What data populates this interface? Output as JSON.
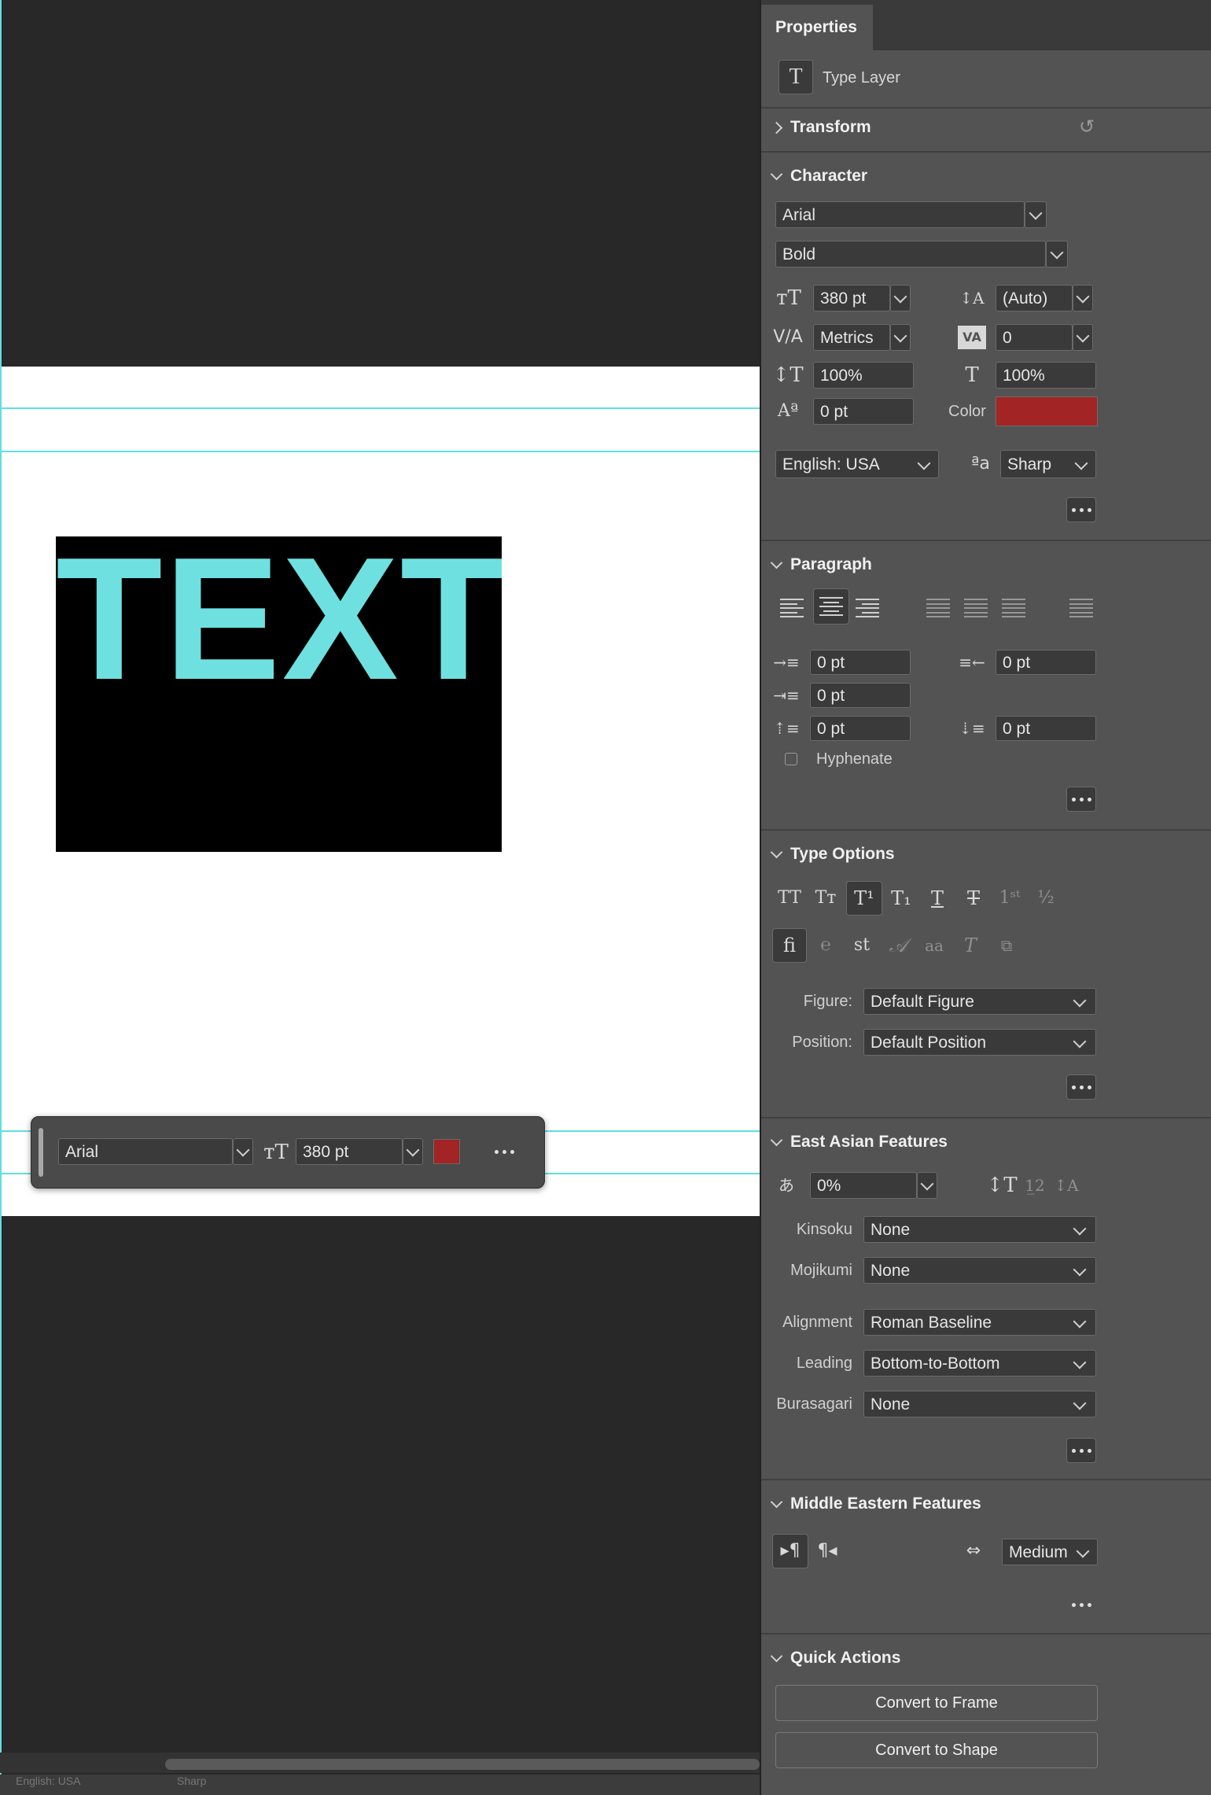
{
  "canvas": {
    "text_frame": {
      "content": "TEXT",
      "text_color": "#6ee0e0",
      "frame_color": "#000000"
    },
    "context_bar": {
      "font": "Arial",
      "size": "380 pt",
      "color": "#a32424"
    },
    "status": {
      "left": "English: USA",
      "right": "Sharp"
    }
  },
  "properties": {
    "tab": "Properties",
    "layer_type": "Type Layer",
    "transform": {
      "title": "Transform"
    },
    "character": {
      "title": "Character",
      "font_family": "Arial",
      "font_style": "Bold",
      "font_size": "380 pt",
      "leading": "(Auto)",
      "kerning": "Metrics",
      "tracking": "0",
      "vertical_scale": "100%",
      "horizontal_scale": "100%",
      "baseline_shift": "0 pt",
      "color_label": "Color",
      "color": "#a32424",
      "language": "English: USA",
      "antialias": "Sharp"
    },
    "paragraph": {
      "title": "Paragraph",
      "indent_left": "0 pt",
      "indent_right": "0 pt",
      "indent_first": "0 pt",
      "space_before": "0 pt",
      "space_after": "0 pt",
      "hyphenate": "Hyphenate"
    },
    "type_options": {
      "title": "Type Options",
      "figure_label": "Figure:",
      "figure_value": "Default Figure",
      "position_label": "Position:",
      "position_value": "Default Position"
    },
    "east_asian": {
      "title": "East Asian Features",
      "tsume": "0%",
      "kinsoku_label": "Kinsoku",
      "kinsoku_value": "None",
      "mojikumi_label": "Mojikumi",
      "mojikumi_value": "None",
      "alignment_label": "Alignment",
      "alignment_value": "Roman Baseline",
      "leading_label": "Leading",
      "leading_value": "Bottom-to-Bottom",
      "burasagari_label": "Burasagari",
      "burasagari_value": "None"
    },
    "middle_eastern": {
      "title": "Middle Eastern Features",
      "kashida": "Medium"
    },
    "quick_actions": {
      "title": "Quick Actions",
      "convert_frame": "Convert to Frame",
      "convert_shape": "Convert to Shape"
    }
  }
}
